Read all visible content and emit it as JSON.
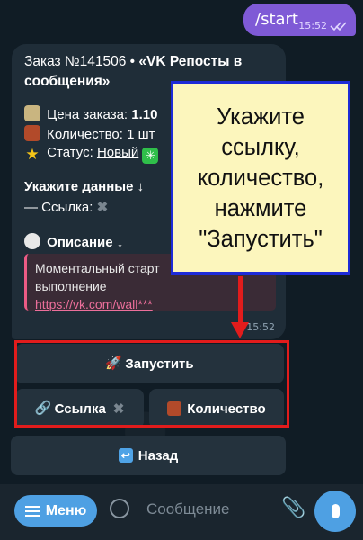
{
  "chat": {
    "outgoing": {
      "text": "/start",
      "time": "15:52"
    },
    "incoming": {
      "title_prefix": "Заказ №141506  •  ",
      "title_bold": "«VK Репосты в сообщения»",
      "price_label": "Цена заказа: ",
      "price_value": "1.10",
      "qty_label": "Количество: ",
      "qty_value": "1 шт",
      "status_label": "Статус: ",
      "status_value": "Новый",
      "data_heading": "Укажите данные ↓",
      "link_label": "— Ссылка: ",
      "link_value": "✖",
      "desc_heading": "Описание ↓",
      "quote_line1": "Моментальный старт",
      "quote_line2": "выполнение",
      "quote_link": "https://vk.com/wall***",
      "time": "15:52"
    }
  },
  "keyboard": {
    "run": "Запустить",
    "link": "Ссылка",
    "link_mark": "✖",
    "quantity": "Количество",
    "back": "Назад"
  },
  "callout": {
    "text": "Укажите ссылку, количество, нажмите \"Запустить\""
  },
  "input_bar": {
    "menu": "Меню",
    "placeholder": "Сообщение"
  },
  "colors": {
    "outgoing_bubble": "#7f5ad6",
    "incoming_bubble": "#1f2d38",
    "accent": "#4ea0e3",
    "highlight_frame": "#e21c1c",
    "callout_bg": "#fcf6bd",
    "callout_border": "#1d2bd8"
  }
}
